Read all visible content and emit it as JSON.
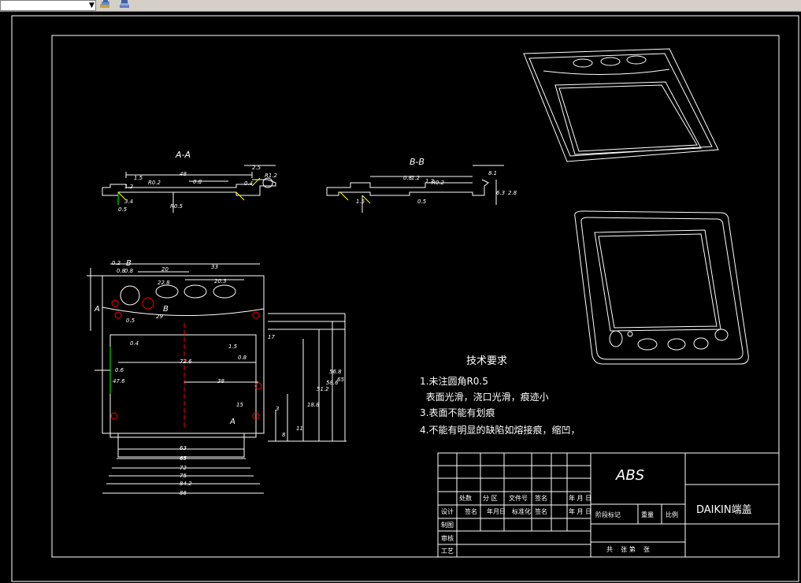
{
  "toolbar": {
    "layer_combo_value": "",
    "icons": [
      "layer-tool-icon",
      "layer-stack-icon"
    ]
  },
  "views": {
    "section_a_label": "A-A",
    "section_b_label": "B-B",
    "marker_a": "A",
    "marker_b": "B"
  },
  "dims_section_a": [
    "48",
    "0.8",
    "2.5",
    "R0.2",
    "R1.2",
    "R0.5",
    "1.2",
    "1.5",
    "3.4",
    "0.5",
    "0.4"
  ],
  "dims_section_b": [
    "0.8",
    "1.2",
    "1.2",
    "R0.2",
    "1.5",
    "0.5",
    "6.3",
    "2.8",
    "8.1"
  ],
  "dims_plan": {
    "top": [
      "0.2",
      "0.8",
      "20",
      "33",
      "0.8",
      "22.8",
      "20.3",
      "29",
      "0.5",
      "0.4"
    ],
    "center": [
      "72.6",
      "38",
      "1.5",
      "0.8",
      "15",
      "0.6",
      "47.6"
    ],
    "right": [
      "17",
      "56.8",
      "51.2",
      "58.6",
      "65",
      "11",
      "8",
      "18.8",
      "3"
    ],
    "bottom": [
      "63",
      "65",
      "72",
      "75",
      "84.2",
      "86"
    ]
  },
  "tech_requirements": {
    "title": "技术要求",
    "lines": [
      "1.未注圆角R0.5",
      "  表面光滑，浇口光滑，痕迹小",
      "3.表面不能有划痕",
      "4.不能有明显的缺陷如熔接痕，缩凹，"
    ]
  },
  "title_block": {
    "material": "ABS",
    "part_name": "DAIKIN端盖",
    "row_labels": [
      "设计",
      "制图",
      "审核",
      "工艺"
    ],
    "header_cells": [
      "处数",
      "分 区",
      "文件号",
      "签名",
      "年 月 日"
    ],
    "design_row_cells": [
      "签名",
      "年月日",
      "标准化",
      "签名",
      "年 月 日"
    ],
    "stage_labels": [
      "阶段标记",
      "重量",
      "比例"
    ],
    "sheet_text": "共    张 第    张"
  }
}
